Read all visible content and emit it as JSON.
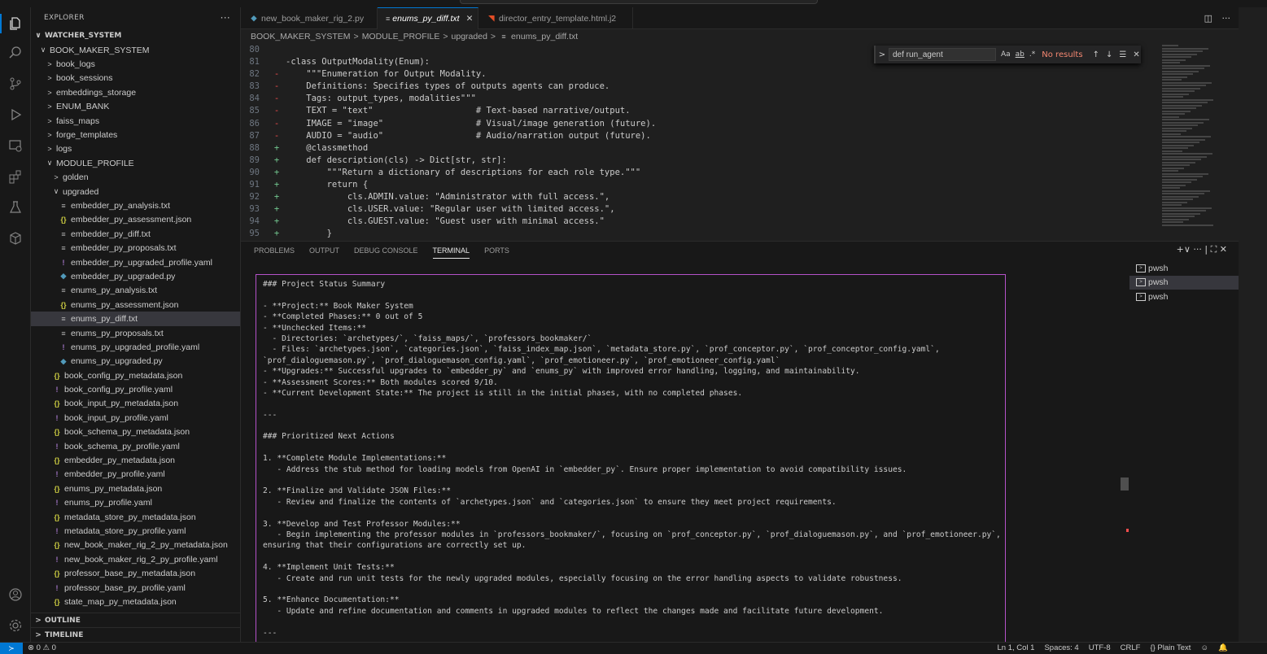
{
  "explorer": {
    "title": "EXPLORER",
    "more": "···",
    "root": "WATCHER_SYSTEM",
    "items": [
      {
        "label": "BOOK_MAKER_SYSTEM",
        "indent": 1,
        "chev": "∨",
        "icon": ""
      },
      {
        "label": "book_logs",
        "indent": 2,
        "chev": ">",
        "icon": ""
      },
      {
        "label": "book_sessions",
        "indent": 2,
        "chev": ">",
        "icon": ""
      },
      {
        "label": "embeddings_storage",
        "indent": 2,
        "chev": ">",
        "icon": ""
      },
      {
        "label": "ENUM_BANK",
        "indent": 2,
        "chev": ">",
        "icon": ""
      },
      {
        "label": "faiss_maps",
        "indent": 2,
        "chev": ">",
        "icon": ""
      },
      {
        "label": "forge_templates",
        "indent": 2,
        "chev": ">",
        "icon": ""
      },
      {
        "label": "logs",
        "indent": 2,
        "chev": ">",
        "icon": ""
      },
      {
        "label": "MODULE_PROFILE",
        "indent": 2,
        "chev": "∨",
        "icon": ""
      },
      {
        "label": "golden",
        "indent": 3,
        "chev": ">",
        "icon": ""
      },
      {
        "label": "upgraded",
        "indent": 3,
        "chev": "∨",
        "icon": ""
      },
      {
        "label": "embedder_py_analysis.txt",
        "indent": 4,
        "chev": "",
        "icon": "txt"
      },
      {
        "label": "embedder_py_assessment.json",
        "indent": 4,
        "chev": "",
        "icon": "json"
      },
      {
        "label": "embedder_py_diff.txt",
        "indent": 4,
        "chev": "",
        "icon": "txt"
      },
      {
        "label": "embedder_py_proposals.txt",
        "indent": 4,
        "chev": "",
        "icon": "txt"
      },
      {
        "label": "embedder_py_upgraded_profile.yaml",
        "indent": 4,
        "chev": "",
        "icon": "yaml"
      },
      {
        "label": "embedder_py_upgraded.py",
        "indent": 4,
        "chev": "",
        "icon": "py"
      },
      {
        "label": "enums_py_analysis.txt",
        "indent": 4,
        "chev": "",
        "icon": "txt"
      },
      {
        "label": "enums_py_assessment.json",
        "indent": 4,
        "chev": "",
        "icon": "json"
      },
      {
        "label": "enums_py_diff.txt",
        "indent": 4,
        "chev": "",
        "icon": "txt",
        "selected": true
      },
      {
        "label": "enums_py_proposals.txt",
        "indent": 4,
        "chev": "",
        "icon": "txt"
      },
      {
        "label": "enums_py_upgraded_profile.yaml",
        "indent": 4,
        "chev": "",
        "icon": "yaml"
      },
      {
        "label": "enums_py_upgraded.py",
        "indent": 4,
        "chev": "",
        "icon": "py"
      },
      {
        "label": "book_config_py_metadata.json",
        "indent": 3,
        "chev": "",
        "icon": "json"
      },
      {
        "label": "book_config_py_profile.yaml",
        "indent": 3,
        "chev": "",
        "icon": "yaml"
      },
      {
        "label": "book_input_py_metadata.json",
        "indent": 3,
        "chev": "",
        "icon": "json"
      },
      {
        "label": "book_input_py_profile.yaml",
        "indent": 3,
        "chev": "",
        "icon": "yaml"
      },
      {
        "label": "book_schema_py_metadata.json",
        "indent": 3,
        "chev": "",
        "icon": "json"
      },
      {
        "label": "book_schema_py_profile.yaml",
        "indent": 3,
        "chev": "",
        "icon": "yaml"
      },
      {
        "label": "embedder_py_metadata.json",
        "indent": 3,
        "chev": "",
        "icon": "json"
      },
      {
        "label": "embedder_py_profile.yaml",
        "indent": 3,
        "chev": "",
        "icon": "yaml"
      },
      {
        "label": "enums_py_metadata.json",
        "indent": 3,
        "chev": "",
        "icon": "json"
      },
      {
        "label": "enums_py_profile.yaml",
        "indent": 3,
        "chev": "",
        "icon": "yaml"
      },
      {
        "label": "metadata_store_py_metadata.json",
        "indent": 3,
        "chev": "",
        "icon": "json"
      },
      {
        "label": "metadata_store_py_profile.yaml",
        "indent": 3,
        "chev": "",
        "icon": "yaml"
      },
      {
        "label": "new_book_maker_rig_2_py_metadata.json",
        "indent": 3,
        "chev": "",
        "icon": "json"
      },
      {
        "label": "new_book_maker_rig_2_py_profile.yaml",
        "indent": 3,
        "chev": "",
        "icon": "yaml"
      },
      {
        "label": "professor_base_py_metadata.json",
        "indent": 3,
        "chev": "",
        "icon": "json"
      },
      {
        "label": "professor_base_py_profile.yaml",
        "indent": 3,
        "chev": "",
        "icon": "yaml"
      },
      {
        "label": "state_map_py_metadata.json",
        "indent": 3,
        "chev": "",
        "icon": "json"
      }
    ],
    "outline": "OUTLINE",
    "timeline": "TIMELINE"
  },
  "tabs": [
    {
      "label": "new_book_maker_rig_2.py",
      "icon": "py",
      "active": false
    },
    {
      "label": "enums_py_diff.txt",
      "icon": "txt",
      "active": true
    },
    {
      "label": "director_entry_template.html.j2",
      "icon": "html",
      "active": false
    }
  ],
  "breadcrumb": [
    "BOOK_MAKER_SYSTEM",
    "MODULE_PROFILE",
    "upgraded",
    "enums_py_diff.txt"
  ],
  "code_lines": [
    {
      "n": "80",
      "m": "",
      "t": ""
    },
    {
      "n": "81",
      "m": "",
      "t": "-class OutputModality(Enum):"
    },
    {
      "n": "82",
      "m": "-",
      "t": "    \"\"\"Enumeration for Output Modality."
    },
    {
      "n": "83",
      "m": "-",
      "t": "    Definitions: Specifies types of outputs agents can produce."
    },
    {
      "n": "84",
      "m": "-",
      "t": "    Tags: output_types, modalities\"\"\""
    },
    {
      "n": "85",
      "m": "-",
      "t": "    TEXT = \"text\"                    # Text-based narrative/output."
    },
    {
      "n": "86",
      "m": "-",
      "t": "    IMAGE = \"image\"                  # Visual/image generation (future)."
    },
    {
      "n": "87",
      "m": "-",
      "t": "    AUDIO = \"audio\"                  # Audio/narration output (future)."
    },
    {
      "n": "88",
      "m": "+",
      "t": "    @classmethod"
    },
    {
      "n": "89",
      "m": "+",
      "t": "    def description(cls) -> Dict[str, str]:"
    },
    {
      "n": "90",
      "m": "+",
      "t": "        \"\"\"Return a dictionary of descriptions for each role type.\"\"\""
    },
    {
      "n": "91",
      "m": "+",
      "t": "        return {"
    },
    {
      "n": "92",
      "m": "+",
      "t": "            cls.ADMIN.value: \"Administrator with full access.\","
    },
    {
      "n": "93",
      "m": "+",
      "t": "            cls.USER.value: \"Regular user with limited access.\","
    },
    {
      "n": "94",
      "m": "+",
      "t": "            cls.GUEST.value: \"Guest user with minimal access.\""
    },
    {
      "n": "95",
      "m": "+",
      "t": "        }"
    }
  ],
  "find": {
    "query": "def run_agent",
    "opt_case": "Aa",
    "opt_word": "ab",
    "opt_regex": ".*",
    "result": "No results"
  },
  "panel_tabs": [
    {
      "label": "PROBLEMS",
      "active": false
    },
    {
      "label": "OUTPUT",
      "active": false
    },
    {
      "label": "DEBUG CONSOLE",
      "active": false
    },
    {
      "label": "TERMINAL",
      "active": true
    },
    {
      "label": "PORTS",
      "active": false
    }
  ],
  "panel_actions": "+∨  ···  |  ⛶  ✕",
  "terminal_lines": [
    "### Project Status Summary",
    "",
    "- **Project:** Book Maker System",
    "- **Completed Phases:** 0 out of 5",
    "- **Unchecked Items:**",
    "  - Directories: `archetypes/`, `faiss_maps/`, `professors_bookmaker/`",
    "  - Files: `archetypes.json`, `categories.json`, `faiss_index_map.json`, `metadata_store.py`, `prof_conceptor.py`, `prof_conceptor_config.yaml`,",
    "`prof_dialoguemason.py`, `prof_dialoguemason_config.yaml`, `prof_emotioneer.py`, `prof_emotioneer_config.yaml`",
    "- **Upgrades:** Successful upgrades to `embedder_py` and `enums_py` with improved error handling, logging, and maintainability.",
    "- **Assessment Scores:** Both modules scored 9/10.",
    "- **Current Development State:** The project is still in the initial phases, with no completed phases.",
    "",
    "---",
    "",
    "### Prioritized Next Actions",
    "",
    "1. **Complete Module Implementations:**",
    "   - Address the stub method for loading models from OpenAI in `embedder_py`. Ensure proper implementation to avoid compatibility issues.",
    "",
    "2. **Finalize and Validate JSON Files:**",
    "   - Review and finalize the contents of `archetypes.json` and `categories.json` to ensure they meet project requirements.",
    "",
    "3. **Develop and Test Professor Modules:**",
    "   - Begin implementing the professor modules in `professors_bookmaker/`, focusing on `prof_conceptor.py`, `prof_dialoguemason.py`, and `prof_emotioneer.py`,",
    "ensuring that their configurations are correctly set up.",
    "",
    "4. **Implement Unit Tests:**",
    "   - Create and run unit tests for the newly upgraded modules, especially focusing on the error handling aspects to validate robustness.",
    "",
    "5. **Enhance Documentation:**",
    "   - Update and refine documentation and comments in upgraded modules to reflect the changes made and facilitate future development.",
    "",
    "---"
  ],
  "terminals": [
    {
      "label": "pwsh",
      "active": false
    },
    {
      "label": "pwsh",
      "active": true
    },
    {
      "label": "pwsh",
      "active": false
    }
  ],
  "status": {
    "problems": "⊗ 0 ⚠ 0",
    "position": "Ln 1, Col 1",
    "spaces": "Spaces: 4",
    "encoding": "UTF-8",
    "eol": "CRLF",
    "language": "{} Plain Text"
  },
  "colors": {
    "accent": "#0078d4",
    "terminal_border": "#b552c8",
    "diff_removed": "#f14c4c",
    "diff_added": "#73c991",
    "find_no_results": "#f48771"
  }
}
